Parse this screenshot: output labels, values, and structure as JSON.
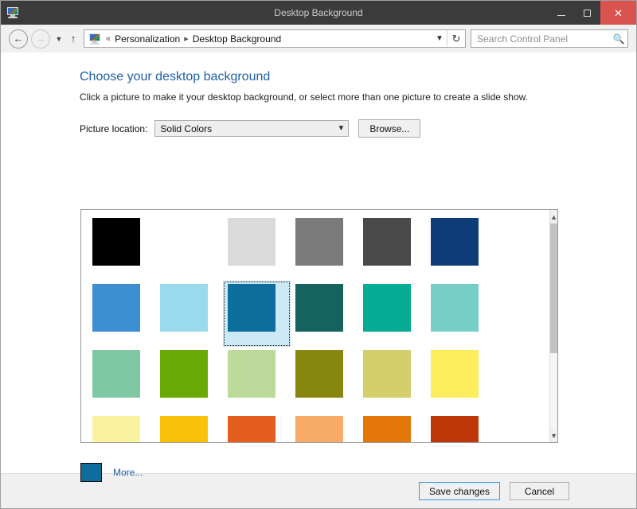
{
  "window": {
    "title": "Desktop Background",
    "icon": "personalization-monitor-icon",
    "controls": {
      "minimize": "minimize-icon",
      "maximize": "maximize-icon",
      "close": "close-icon",
      "close_color": "#d9534f"
    }
  },
  "toolbar": {
    "back": "back-arrow-icon",
    "forward": "forward-arrow-icon",
    "recent_caret": "chevron-down-icon",
    "up": "up-arrow-icon",
    "address": {
      "icon": "personalization-monitor-icon",
      "leading_chevrons": "«",
      "crumbs": [
        "Personalization",
        "Desktop Background"
      ],
      "separator": "▸",
      "caret": "chevron-down-icon",
      "refresh": "refresh-icon"
    },
    "search": {
      "placeholder": "Search Control Panel",
      "value": "",
      "icon": "search-icon"
    }
  },
  "main": {
    "heading": "Choose your desktop background",
    "heading_color": "#1f5fa9",
    "subheading": "Click a picture to make it your desktop background, or select more than one picture to create a slide show.",
    "picture_location": {
      "label": "Picture location:",
      "selected": "Solid Colors",
      "options": [
        "Solid Colors"
      ],
      "caret": "chevron-down-icon"
    },
    "browse_label": "Browse...",
    "more": {
      "swatch_color": "#0d6e9e",
      "label": "More...",
      "link_color": "#1f5fa9"
    },
    "scrollbar": {
      "up_arrow": "chevron-up-icon",
      "down_arrow": "chevron-down-icon",
      "thumb_percent": 63
    }
  },
  "swatches": [
    {
      "name": "black",
      "color": "#000000",
      "selected": false
    },
    {
      "name": "white",
      "color": "#ffffff",
      "selected": false
    },
    {
      "name": "light-gray",
      "color": "#dadada",
      "selected": false
    },
    {
      "name": "medium-gray",
      "color": "#7a7a7a",
      "selected": false
    },
    {
      "name": "dark-gray",
      "color": "#494949",
      "selected": false
    },
    {
      "name": "navy-blue",
      "color": "#0d3c78",
      "selected": false
    },
    {
      "name": "steel-blue",
      "color": "#3d8fd1",
      "selected": false
    },
    {
      "name": "sky-blue",
      "color": "#9adaec",
      "selected": false
    },
    {
      "name": "ocean-blue",
      "color": "#0d6e9e",
      "selected": true
    },
    {
      "name": "deep-teal",
      "color": "#14635f",
      "selected": false
    },
    {
      "name": "turquoise",
      "color": "#06ac94",
      "selected": false
    },
    {
      "name": "aqua-mint",
      "color": "#77cdc8",
      "selected": false
    },
    {
      "name": "mint-green",
      "color": "#7fc8a3",
      "selected": false
    },
    {
      "name": "grass-green",
      "color": "#6aa806",
      "selected": false
    },
    {
      "name": "pale-green",
      "color": "#bcdb9b",
      "selected": false
    },
    {
      "name": "olive",
      "color": "#87870f",
      "selected": false
    },
    {
      "name": "khaki",
      "color": "#d4cf6a",
      "selected": false
    },
    {
      "name": "bright-yellow",
      "color": "#fced5d",
      "selected": false
    },
    {
      "name": "pale-yellow",
      "color": "#fbf2a0",
      "selected": false
    },
    {
      "name": "golden-yellow",
      "color": "#fcc20b",
      "selected": false
    },
    {
      "name": "orange-red",
      "color": "#e65d20",
      "selected": false
    },
    {
      "name": "peach",
      "color": "#f7ab66",
      "selected": false
    },
    {
      "name": "dark-orange",
      "color": "#e37708",
      "selected": false
    },
    {
      "name": "brick-red",
      "color": "#bf3608",
      "selected": false
    }
  ],
  "footer": {
    "save_label": "Save changes",
    "cancel_label": "Cancel",
    "default_border_color": "#3b9ae1"
  }
}
